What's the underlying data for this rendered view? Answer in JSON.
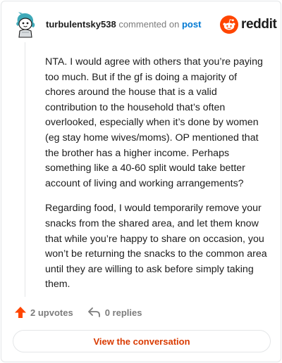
{
  "header": {
    "username": "turbulentsky538",
    "action_text": "commented on",
    "link_text": "post",
    "brand_word": "reddit"
  },
  "icons": {
    "avatar": "snoo-avatar-icon",
    "brand": "reddit-logo-icon",
    "upvote": "upvote-arrow-icon",
    "reply": "reply-arrow-icon"
  },
  "comment": {
    "paragraphs": [
      "NTA. I would agree with others that you’re paying too much. But if the gf is doing a majority of chores around the house that is a valid contribution to the household that’s often overlooked, especially when it’s done by women (eg stay home wives/moms). OP mentioned that the brother has a higher income. Perhaps something like a 40-60 split would take better account of living and working arrangements?",
      "Regarding food, I would temporarily remove your snacks from the shared area, and let them know that while you’re happy to share on occasion, you won’t be returning the snacks to the common area until they are willing to ask before simply taking them."
    ]
  },
  "actions": {
    "upvotes": "2 upvotes",
    "replies": "0 replies"
  },
  "cta": {
    "label": "View the conversation"
  },
  "colors": {
    "brand_orange": "#ff4500",
    "link_blue": "#0079d3",
    "cta_text": "#d93a00",
    "muted": "#7c7c7c"
  }
}
